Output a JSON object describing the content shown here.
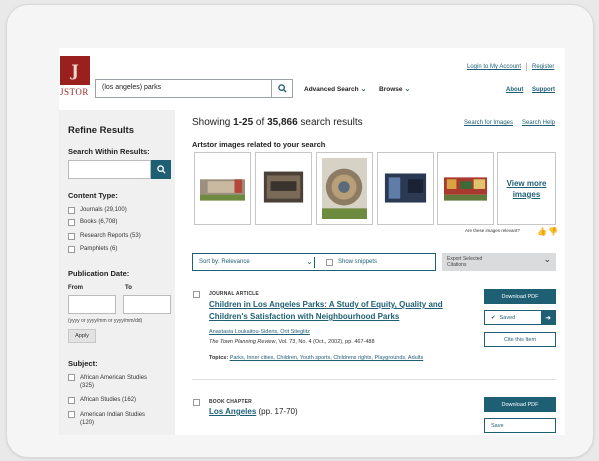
{
  "header": {
    "logo_glyph": "J",
    "logo_text": "JSTOR",
    "search_value": "(los angeles) parks",
    "nav": {
      "advanced": "Advanced Search",
      "browse": "Browse"
    },
    "links": {
      "login": "Login to My Account",
      "register": "Register",
      "about": "About",
      "support": "Support"
    }
  },
  "sidebar": {
    "title": "Refine Results",
    "search_within": "Search Within Results:",
    "content_type": "Content Type:",
    "content_types": [
      "Journals (29,100)",
      "Books (6,708)",
      "Research Reports (53)",
      "Pamphlets (6)"
    ],
    "pub_date": "Publication Date:",
    "from": "From",
    "to": "To",
    "date_hint": "(yyyy or yyyy/mm or yyyy/mm/dd)",
    "apply": "Apply",
    "subject": "Subject:",
    "subjects": [
      {
        "line1": "African American Studies",
        "line2": "(325)"
      },
      {
        "line1": "African Studies (162)",
        "line2": ""
      },
      {
        "line1": "American Indian Studies",
        "line2": "(120)"
      }
    ]
  },
  "main": {
    "showing_prefix": "Showing ",
    "range": "1-25",
    "of": " of ",
    "total": "35,866",
    "suffix": " search results",
    "search_images": "Search for Images",
    "search_help": "Search Help",
    "artstor_title": "Artstor images related to your search",
    "view_more": "View more images",
    "relevant_q": "Are these images relevant?",
    "sort_label": "Sort by: Relevance",
    "show_snippets": "Show snippets",
    "export_line1": "Export Selected",
    "export_line2": "Citations"
  },
  "results": [
    {
      "type": "JOURNAL ARTICLE",
      "title_line1": "Children in Los Angeles Parks: A Study of Equity, Quality and",
      "title_line2": "Children's Satisfaction with Neighbourhood Parks",
      "authors": "Anastasia Loukaitou-Sideris, Orit Stieglitz",
      "journal": "The Town Planning Review",
      "citation": ", Vol. 73, No. 4 (Oct., 2002), pp. 467-488",
      "topics_label": "Topics:",
      "topics": "Parks, Inner cities, Children, Youth sports, Childrens rights, Playgrounds, Adults",
      "download": "Download PDF",
      "saved": "Saved",
      "cite": "Cite this Item"
    },
    {
      "type": "BOOK CHAPTER",
      "title": "Los Angeles",
      "pages": " (pp. 17-70)",
      "download": "Download PDF",
      "save": "Save"
    }
  ],
  "colors": {
    "accent": "#1e5f74",
    "brand": "#9a1f1f",
    "sidebar_bg": "#f0f0f0"
  }
}
